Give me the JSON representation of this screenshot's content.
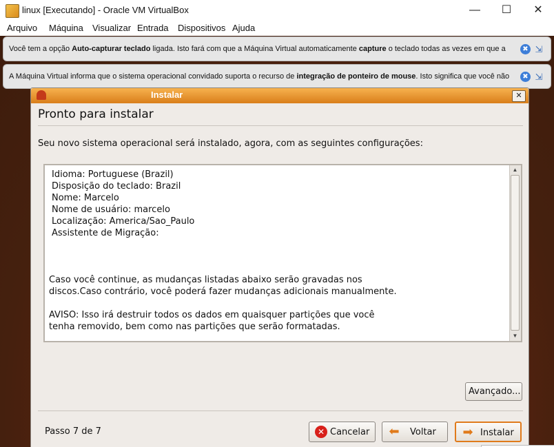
{
  "window": {
    "title": "linux [Executando] - Oracle VM VirtualBox",
    "controls": {
      "minimize": "—",
      "maximize": "☐",
      "close": "✕"
    }
  },
  "menu": [
    "Arquivo",
    "Máquina",
    "Visualizar",
    "Entrada",
    "Dispositivos",
    "Ajuda"
  ],
  "notices": [
    {
      "t1": "Você tem a opção ",
      "b1": "Auto-capturar teclado",
      "t2": " ligada. Isto fará com que a Máquina Virtual automaticamente ",
      "b2": "capture",
      "t3": " o teclado todas as vezes em que a"
    },
    {
      "t1": "A Máquina Virtual informa que o sistema operacional convidado suporta o recurso de ",
      "b1": "integração de ponteiro de mouse",
      "t2": ". Isto significa que você não",
      "b2": "",
      "t3": ""
    }
  ],
  "notice_icons": {
    "info": "✖",
    "mute": "⇲"
  },
  "dialog": {
    "title": "Instalar",
    "close_glyph": "✕",
    "heading": "Pronto para instalar",
    "intro": "Seu novo sistema operacional será instalado, agora, com as seguintes configurações:",
    "summary_lines": [
      "Idioma: Portuguese (Brazil)",
      "Disposição do teclado: Brazil",
      "Nome: Marcelo",
      "Nome de usuário: marcelo",
      "Localização: America/Sao_Paulo",
      "Assistente de Migração:",
      "Caso você continue, as mudanças listadas abaixo serão gravadas nos",
      "discos.Caso contrário, você poderá fazer mudanças adicionais manualmente.",
      "AVISO: Isso irá destruir todos os dados em quaisquer partições que você",
      "tenha removido, bem como nas partições que serão formatadas."
    ],
    "advanced_label": "Avançado...",
    "step_label": "Passo 7 de 7",
    "buttons": {
      "cancel": "Cancelar",
      "back": "Voltar",
      "install": "Instalar"
    },
    "scroll_arrows": {
      "up": "▲",
      "down": "▼"
    }
  },
  "colors": {
    "accent": "#e07a1a",
    "desktop": "#4a1f0e"
  }
}
